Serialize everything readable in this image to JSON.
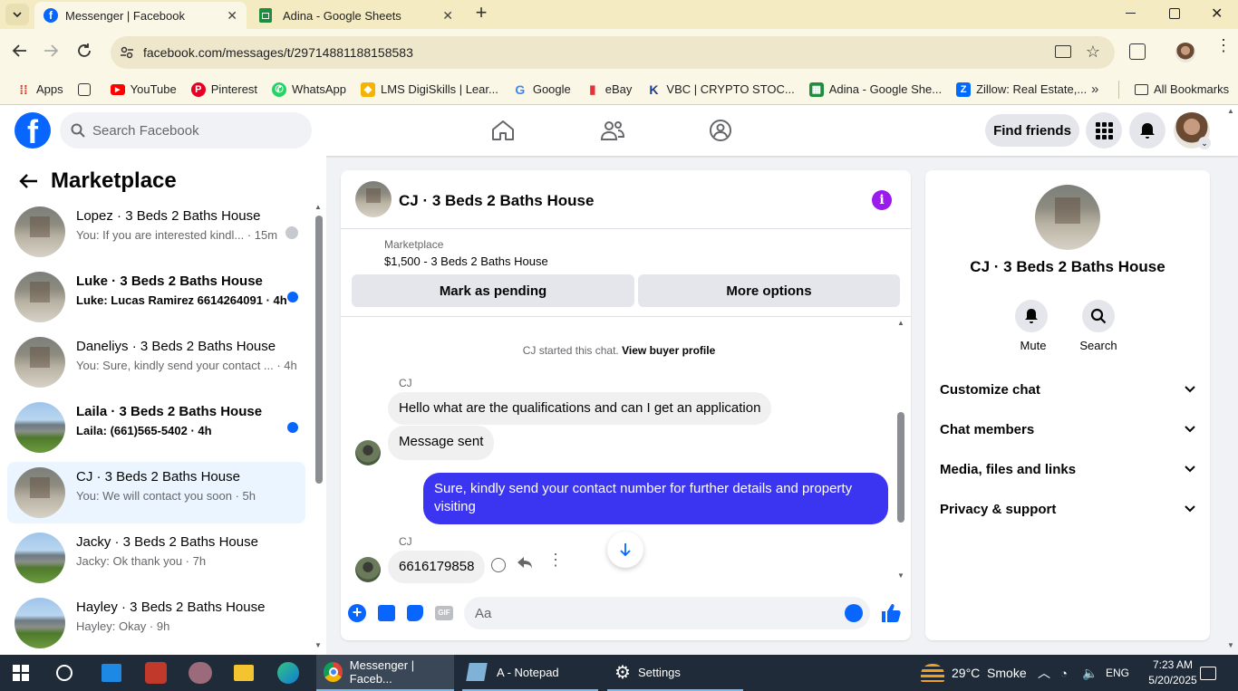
{
  "browser": {
    "tabs": [
      {
        "title": "Messenger | Facebook",
        "active": true
      },
      {
        "title": "Adina - Google Sheets",
        "active": false
      }
    ],
    "url": "facebook.com/messages/t/29714881188158583",
    "bookmarks": [
      "Apps",
      "YouTube",
      "Pinterest",
      "WhatsApp",
      "LMS DigiSkills | Lear...",
      "Google",
      "eBay",
      "VBC | CRYPTO STOC...",
      "Adina - Google She...",
      "Zillow: Real Estate,..."
    ],
    "all_bookmarks": "All Bookmarks"
  },
  "fb_header": {
    "search_placeholder": "Search Facebook",
    "find_friends": "Find friends"
  },
  "left": {
    "title": "Marketplace",
    "conversations": [
      {
        "name": "Lopez · 3 Beds 2 Baths House",
        "preview": "You: If you are interested kindl... · 15m",
        "unread": false
      },
      {
        "name": "Luke · 3 Beds 2 Baths House",
        "preview": "Luke: Lucas Ramirez 6614264091 · 4h",
        "unread": true
      },
      {
        "name": "Daneliys · 3 Beds 2 Baths House",
        "preview": "You: Sure, kindly send your contact ... · 4h",
        "unread": false
      },
      {
        "name": "Laila · 3 Beds 2 Baths House",
        "preview": "Laila: (661)565-5402 · 4h",
        "unread": true
      },
      {
        "name": "CJ · 3 Beds 2 Baths House",
        "preview": "You: We will contact you soon · 5h",
        "unread": false
      },
      {
        "name": "Jacky · 3 Beds 2 Baths House",
        "preview": "Jacky: Ok thank you · 7h",
        "unread": false
      },
      {
        "name": "Hayley · 3 Beds 2 Baths House",
        "preview": "Hayley: Okay · 9h",
        "unread": false
      }
    ]
  },
  "chat": {
    "title": "CJ · 3 Beds 2 Baths House",
    "listing_label": "Marketplace",
    "listing_price": "$1,500 - 3 Beds 2 Baths House",
    "mark_pending": "Mark as pending",
    "more_options": "More options",
    "system_line_1": "CJ started this chat.",
    "system_line_2": "View buyer profile",
    "sender_1": "CJ",
    "msg_1": "Hello what are the qualifications and can I get an application",
    "msg_2": "Message sent",
    "msg_3": "Sure, kindly send your contact number for further details and property visiting",
    "sender_2": "CJ",
    "msg_4": "6616179858",
    "composer_placeholder": "Aa"
  },
  "right": {
    "title": "CJ · 3 Beds 2 Baths House",
    "mute": "Mute",
    "search": "Search",
    "sections": [
      "Customize chat",
      "Chat members",
      "Media, files and links",
      "Privacy & support"
    ]
  },
  "taskbar": {
    "apps": [
      "Messenger | Faceb...",
      "A - Notepad",
      "Settings"
    ],
    "weather": "29°C  Smoke",
    "lang": "ENG",
    "time": "7:23 AM",
    "date": "5/20/2025"
  },
  "colors": {
    "fb_blue": "#0866ff",
    "bubble_self": "#3b34f0",
    "tab_strip": "#f5ebc3",
    "info_purple": "#9b1aed"
  }
}
